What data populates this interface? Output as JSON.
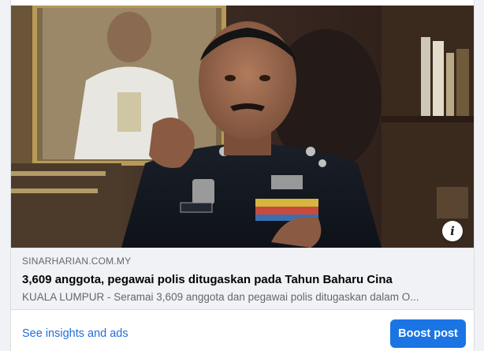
{
  "link_preview": {
    "domain": "SINARHARIAN.COM.MY",
    "headline": "3,609 anggota, pegawai polis ditugaskan pada Tahun Baharu Cina",
    "description": "KUALA LUMPUR - Seramai 3,609 anggota dan pegawai polis ditugaskan dalam O...",
    "info_icon": "i"
  },
  "footer": {
    "insights_label": "See insights and ads",
    "boost_label": "Boost post"
  },
  "colors": {
    "link_blue": "#216fdb",
    "boost_blue": "#1b74e4",
    "meta_bg": "#f0f2f5"
  }
}
